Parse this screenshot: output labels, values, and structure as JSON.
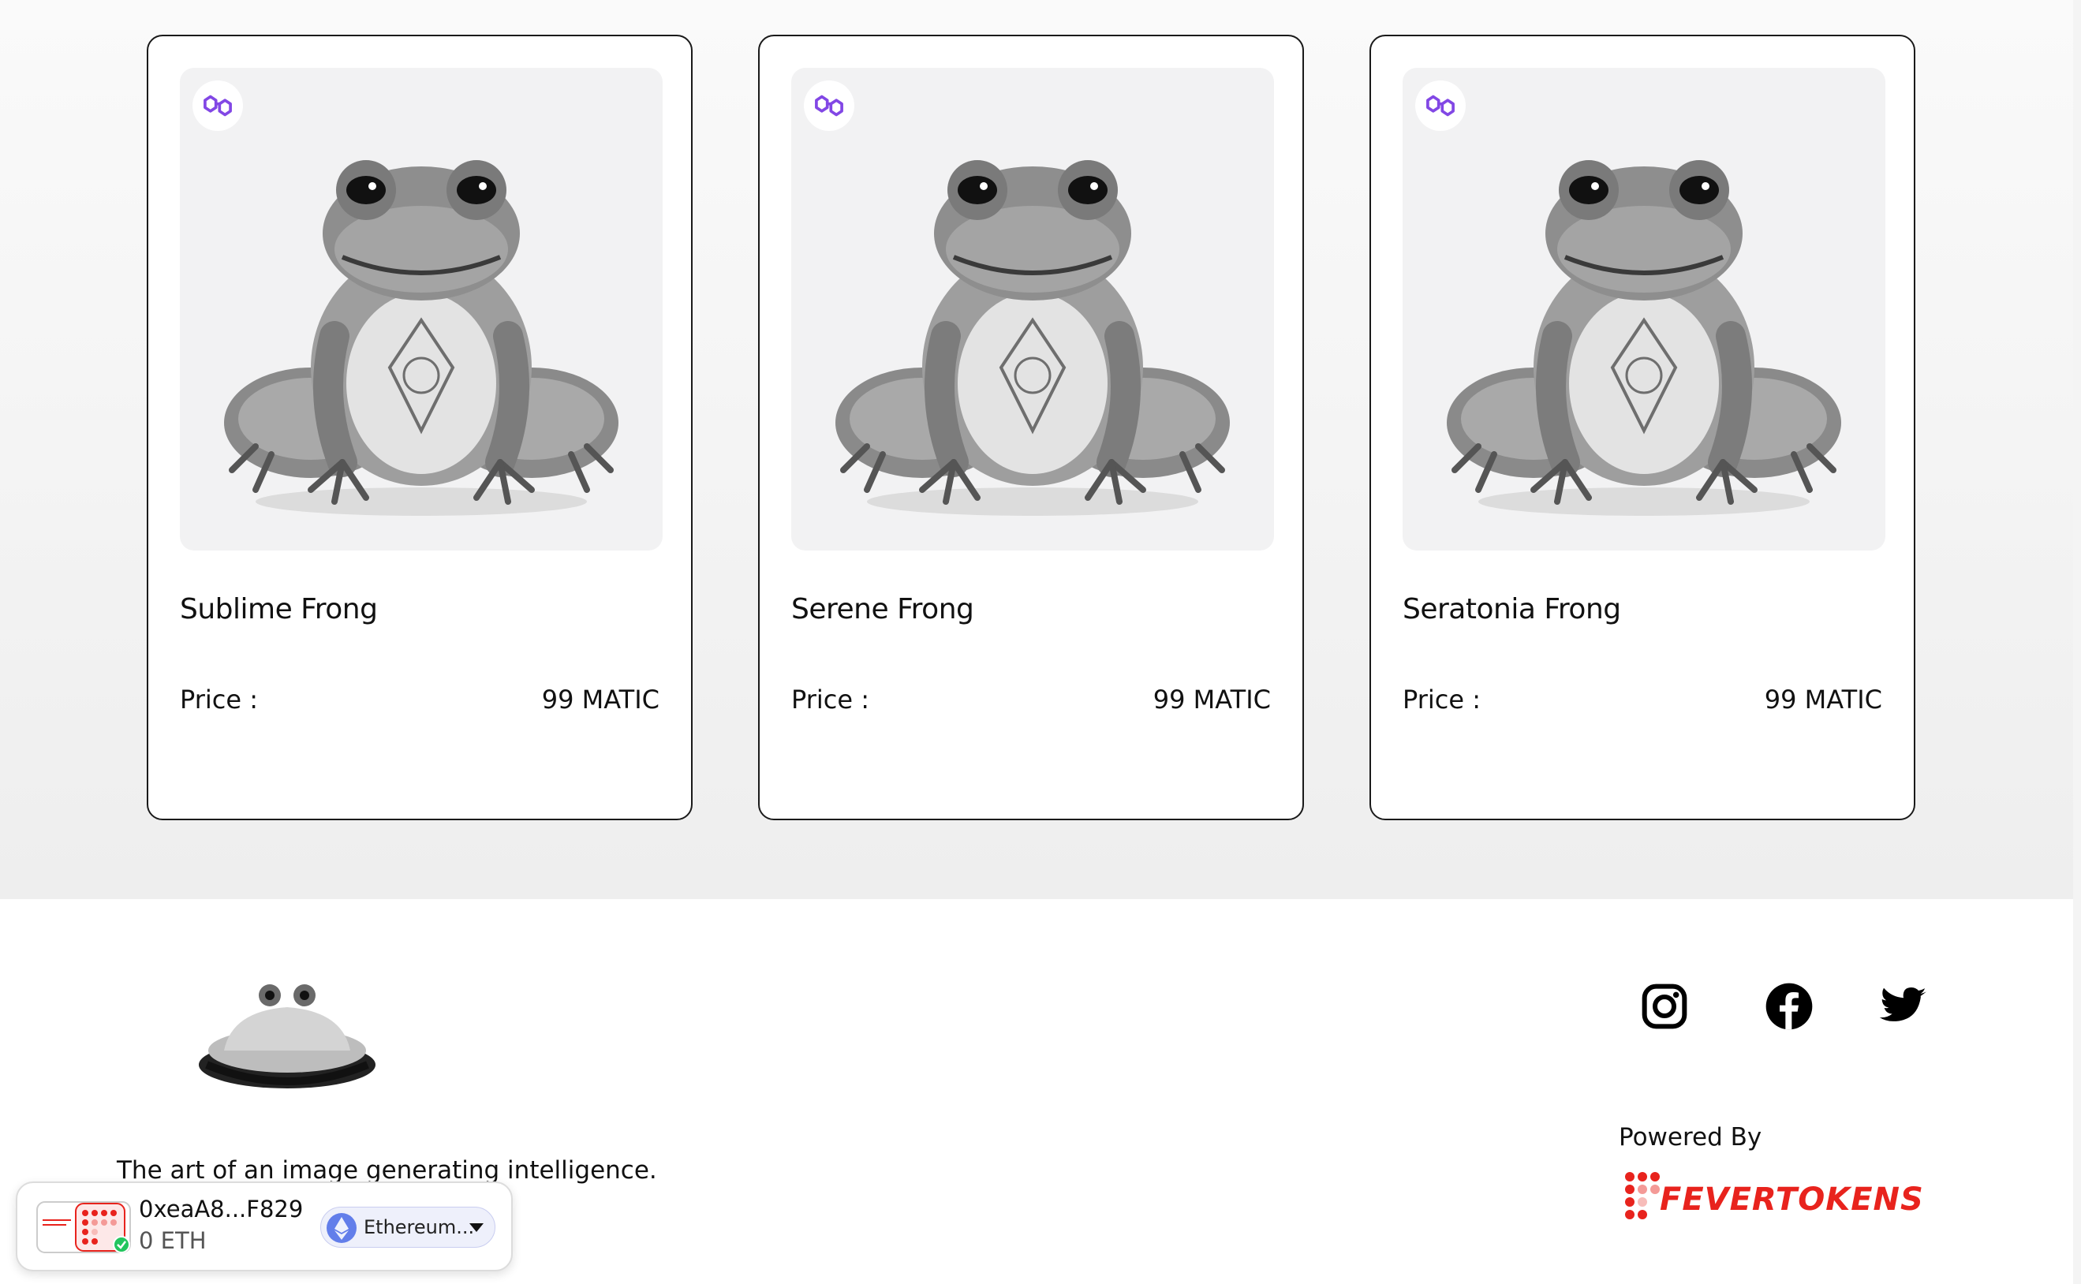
{
  "gallery": {
    "cards": [
      {
        "name": "Sublime Frong",
        "price_label": "Price :",
        "price_value": "99 MATIC",
        "chain_icon": "polygon-icon"
      },
      {
        "name": "Serene Frong",
        "price_label": "Price :",
        "price_value": "99 MATIC",
        "chain_icon": "polygon-icon"
      },
      {
        "name": "Seratonia Frong",
        "price_label": "Price :",
        "price_value": "99 MATIC",
        "chain_icon": "polygon-icon"
      }
    ]
  },
  "footer": {
    "tagline": "The art of an image generating intelligence.",
    "social": [
      "instagram-icon",
      "facebook-icon",
      "twitter-icon"
    ],
    "powered_by": "Powered By",
    "brand": "FEVERTOKENS"
  },
  "wallet": {
    "address": "0xeaA8...F829",
    "balance": "0 ETH",
    "network": "Ethereum..."
  },
  "colors": {
    "polygon": "#8247e5",
    "brand_red": "#e8231d",
    "card_border": "#1a1a1a",
    "gallery_bg": "#eeeeee"
  }
}
